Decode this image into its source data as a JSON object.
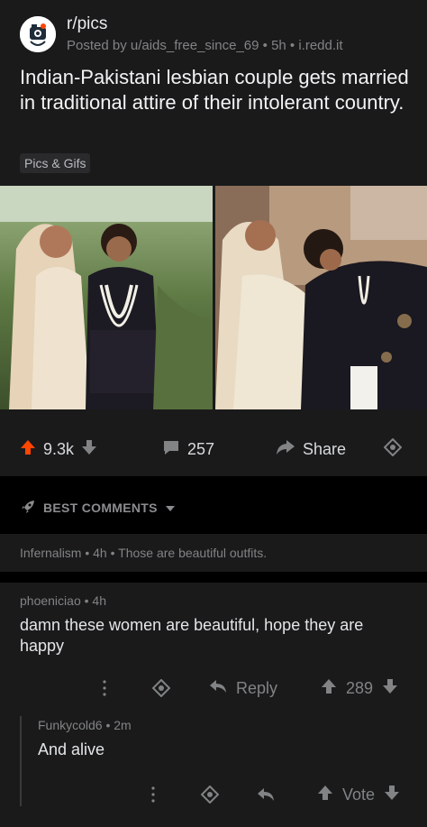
{
  "post": {
    "subreddit": "r/pics",
    "meta": "Posted by u/aids_free_since_69 • 5h • i.redd.it",
    "title": "Indian-Pakistani lesbian couple gets married in traditional attire of their intolerant country.",
    "flair": "Pics & Gifs",
    "votes": "9.3k",
    "comments": "257",
    "share_label": "Share"
  },
  "sort": {
    "label": "BEST COMMENTS"
  },
  "collapsed_comment": {
    "text": "Infernalism • 4h • Those are beautiful outfits."
  },
  "comment": {
    "meta": "phoeniciao • 4h",
    "body": "damn these women are beautiful, hope they are happy",
    "reply_label": "Reply",
    "score": "289"
  },
  "reply": {
    "meta": "Funkycold6 • 2m",
    "body": "And alive",
    "vote_label": "Vote"
  },
  "colors": {
    "upvote_active": "#ff4500",
    "background": "#1a1a1b"
  }
}
